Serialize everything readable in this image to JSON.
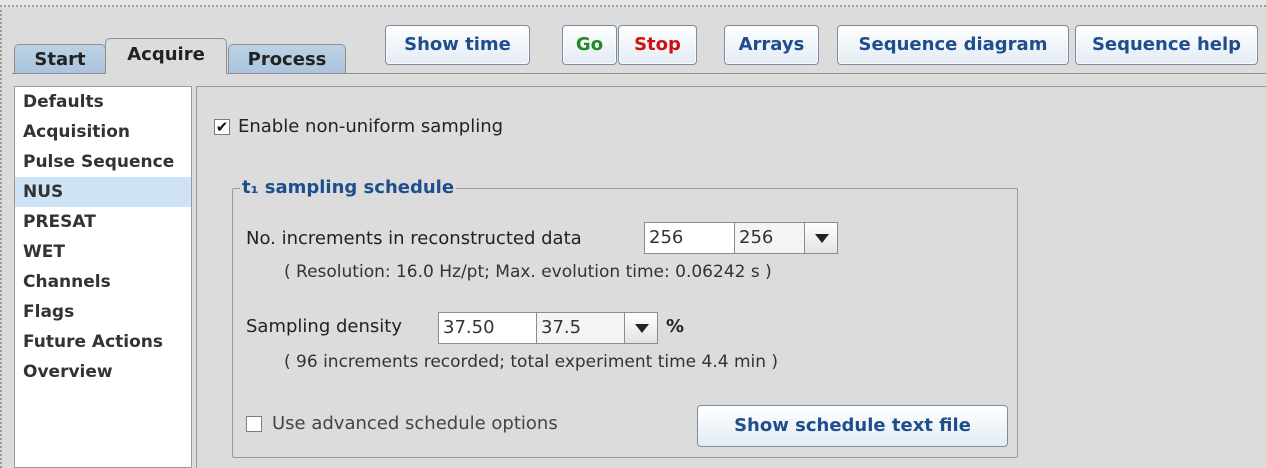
{
  "tabs": [
    {
      "label": "Start",
      "active": false
    },
    {
      "label": "Acquire",
      "active": true
    },
    {
      "label": "Process",
      "active": false
    }
  ],
  "toolbar": {
    "show_time": "Show time",
    "go": "Go",
    "stop": "Stop",
    "arrays": "Arrays",
    "sequence_diagram": "Sequence diagram",
    "sequence_help": "Sequence help"
  },
  "sidebar": {
    "items": [
      {
        "label": "Defaults"
      },
      {
        "label": "Acquisition"
      },
      {
        "label": "Pulse Sequence"
      },
      {
        "label": "NUS",
        "selected": true
      },
      {
        "label": "PRESAT"
      },
      {
        "label": "WET"
      },
      {
        "label": "Channels"
      },
      {
        "label": "Flags"
      },
      {
        "label": "Future Actions"
      },
      {
        "label": "Overview"
      }
    ]
  },
  "nus": {
    "enable_label": "Enable non-uniform sampling",
    "enable_checked": true,
    "group_title": "t₁ sampling schedule",
    "increments_label": "No. increments in reconstructed data",
    "increments_value": "256",
    "increments_combo": "256",
    "resolution_text": "( Resolution: 16.0 Hz/pt; Max. evolution time: 0.06242 s )",
    "density_label": "Sampling density",
    "density_value": "37.50",
    "density_combo": "37.5",
    "density_unit": "%",
    "recorded_text": "( 96 increments recorded; total experiment time 4.4 min )",
    "advanced_label": "Use advanced schedule options",
    "advanced_checked": false,
    "show_schedule_button": "Show schedule text file"
  },
  "colors": {
    "accent": "#1f4e8c",
    "go": "#1f8a1f",
    "stop": "#cc1111",
    "selected_bg": "#cfe3f7"
  }
}
